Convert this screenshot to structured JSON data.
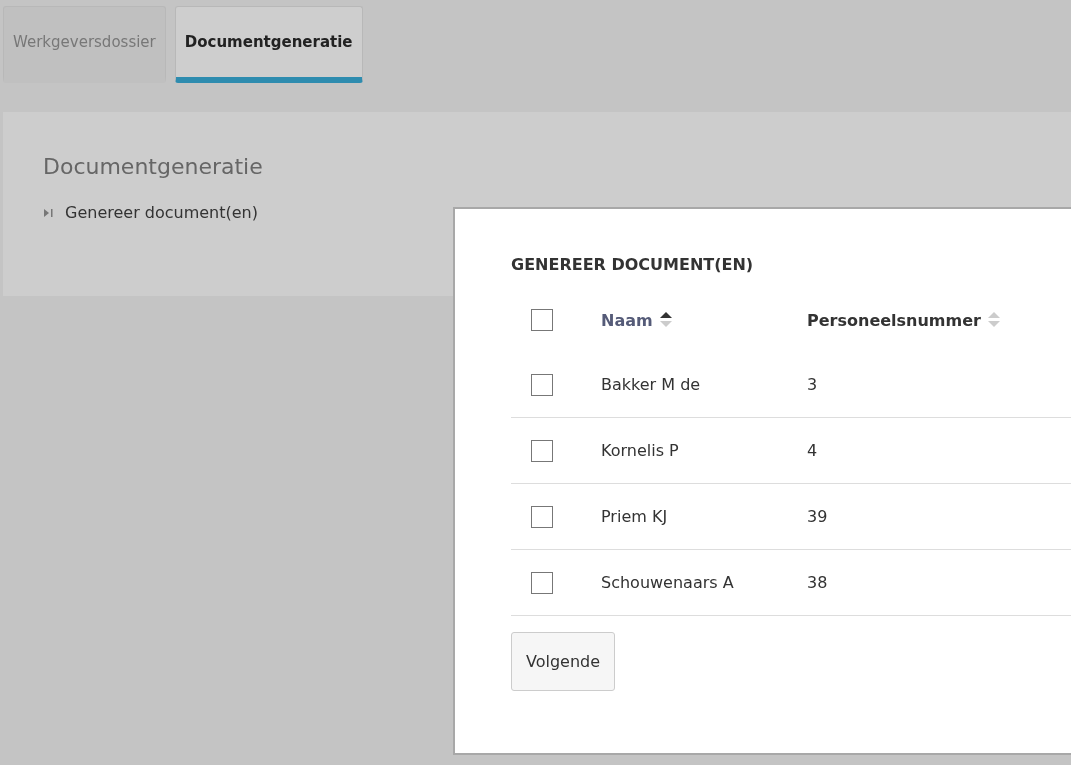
{
  "tabs": [
    {
      "label": "Werkgeversdossier",
      "selected": false
    },
    {
      "label": "Documentgeneratie",
      "selected": true
    }
  ],
  "panel": {
    "title": "Documentgeneratie",
    "items": [
      {
        "label": "Genereer document(en)",
        "expanded": false
      }
    ]
  },
  "dialog": {
    "title": "GENEREER DOCUMENT(EN)",
    "select_all": {
      "checked": false
    },
    "columns": [
      {
        "label": "Naam",
        "sorted": true
      },
      {
        "label": "Personeelsnummer",
        "sorted": false
      }
    ],
    "rows": [
      {
        "checked": false,
        "cells": [
          "Bakker M de",
          "3"
        ]
      },
      {
        "checked": false,
        "cells": [
          "Kornelis P",
          "4"
        ]
      },
      {
        "checked": false,
        "cells": [
          "Priem KJ",
          "39"
        ]
      },
      {
        "checked": false,
        "cells": [
          "Schouwenaars A",
          "38"
        ]
      }
    ],
    "button": "Volgende"
  }
}
